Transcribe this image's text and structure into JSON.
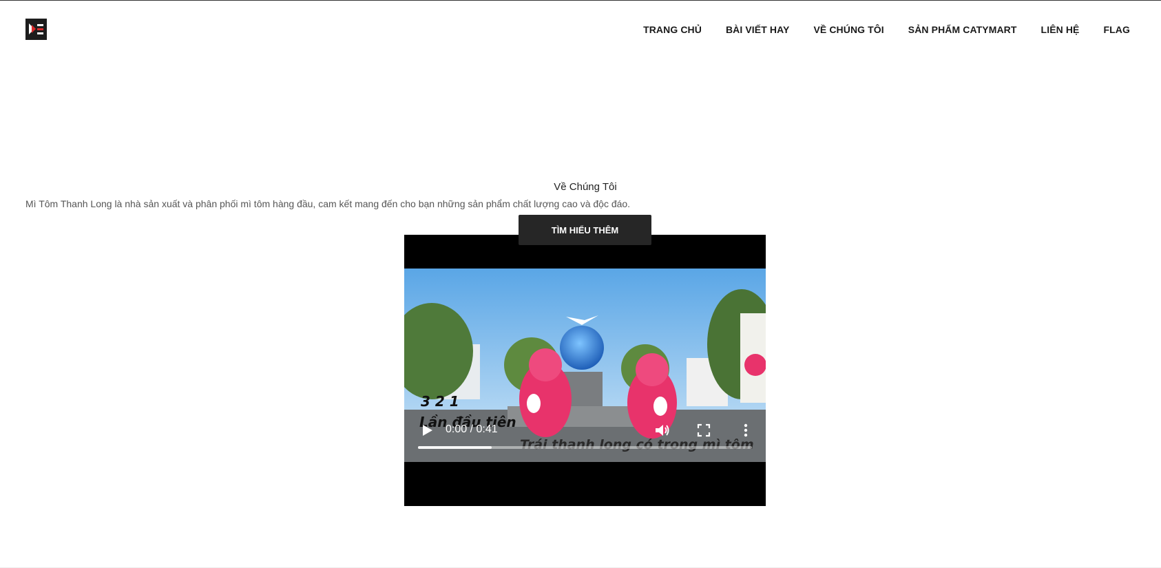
{
  "header": {
    "logo_name": "brand-logo",
    "nav": [
      {
        "label": "TRANG CHỦ"
      },
      {
        "label": "BÀI VIẾT HAY"
      },
      {
        "label": "VỀ CHÚNG TÔI"
      },
      {
        "label": "SẢN PHẨM CATYMART"
      },
      {
        "label": "LIÊN HỆ"
      },
      {
        "label": "FLAG"
      }
    ]
  },
  "about": {
    "title": "Về Chúng Tôi",
    "description": "Mì Tôm Thanh Long là nhà sản xuất và phân phối mì tôm hàng đầu, cam kết mang đến cho bạn những sản phẩm chất lượng cao và độc đáo.",
    "button_label": "TÌM HIỂU THÊM"
  },
  "video": {
    "time_display": "0:00 / 0:41",
    "progress_fraction": 0.22,
    "icons": {
      "play": "play-icon",
      "volume": "volume-icon",
      "fullscreen": "fullscreen-icon",
      "more": "more-options-icon"
    },
    "frame_caption_left_1": "3 2 1",
    "frame_caption_left_2": "Lần đầu tiên",
    "frame_caption_right": "Trái thanh long có trong mì tôm"
  },
  "colors": {
    "button_bg": "#262626",
    "mascot_pink": "#e8336b",
    "sky_blue": "#6fb3e8"
  }
}
